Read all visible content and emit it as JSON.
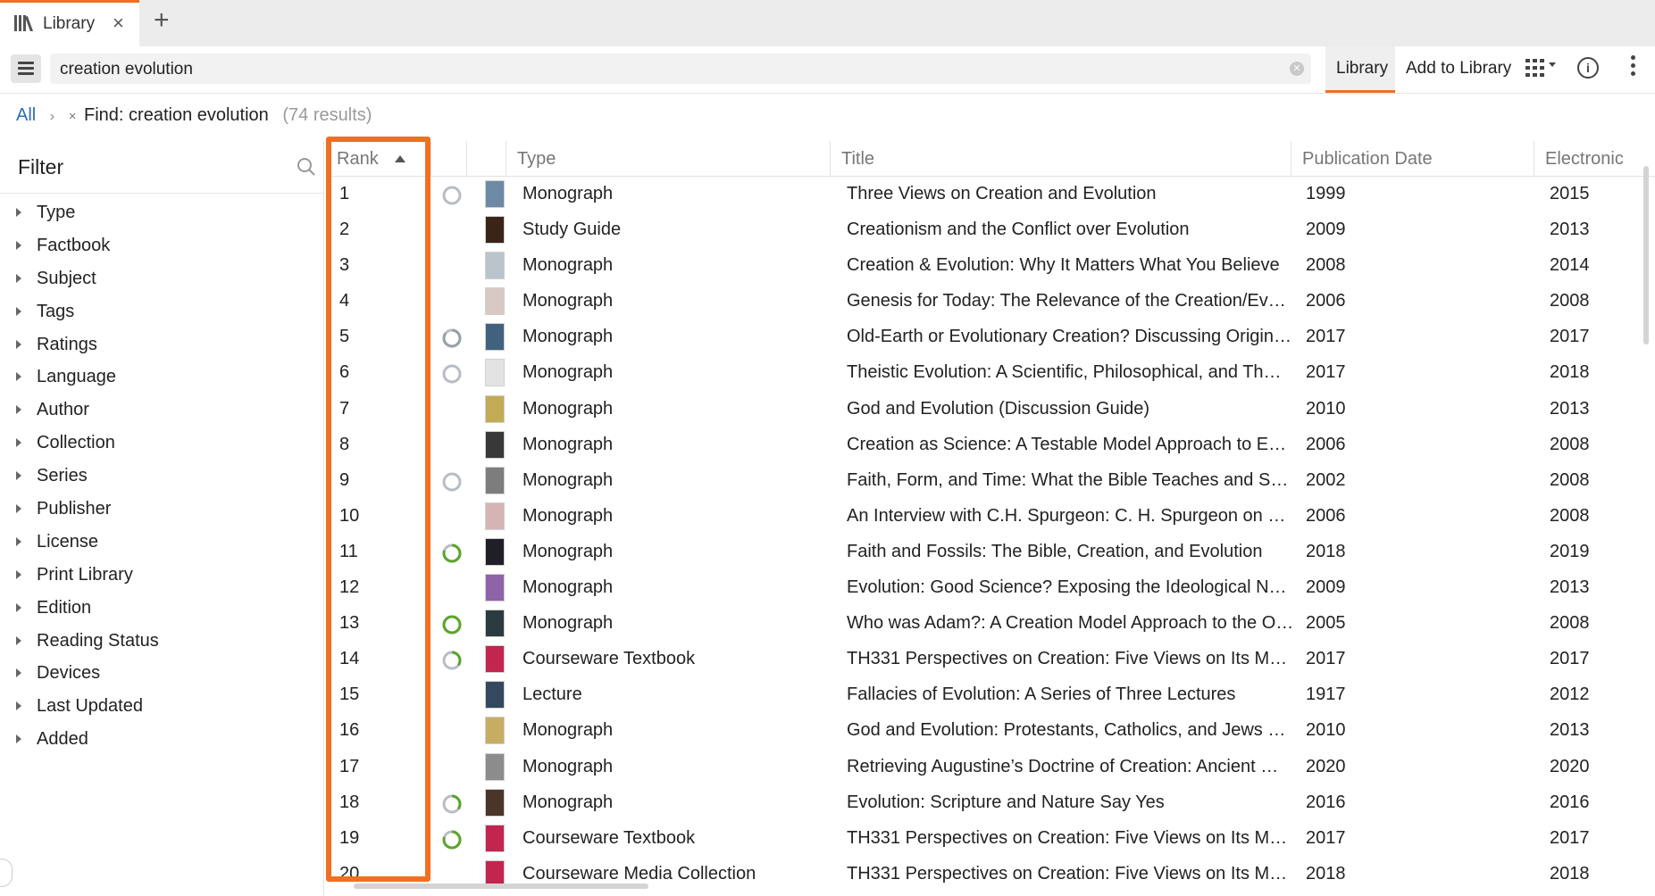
{
  "tab": {
    "label": "Library",
    "close": "×",
    "add": "+"
  },
  "toolbar": {
    "search_value": "creation evolution",
    "library_button": "Library",
    "add_to_library": "Add to Library",
    "info": "i"
  },
  "breadcrumb": {
    "all": "All",
    "separator": "›",
    "remove": "×",
    "find": "Find: creation evolution",
    "count": "(74 results)"
  },
  "filter": {
    "title": "Filter",
    "items": [
      "Type",
      "Factbook",
      "Subject",
      "Tags",
      "Ratings",
      "Language",
      "Author",
      "Collection",
      "Series",
      "Publisher",
      "License",
      "Print Library",
      "Edition",
      "Reading Status",
      "Devices",
      "Last Updated",
      "Added"
    ]
  },
  "table": {
    "columns": {
      "rank": "Rank",
      "type": "Type",
      "title": "Title",
      "pub_date": "Publication Date",
      "electronic": "Electronic"
    },
    "rows": [
      {
        "rank": "1",
        "status": "empty",
        "thumb": "#6c8aa5",
        "type": "Monograph",
        "title": "Three Views on Creation and Evolution",
        "pub": "1999",
        "elec": "2015"
      },
      {
        "rank": "2",
        "status": "none",
        "thumb": "#3a2418",
        "type": "Study Guide",
        "title": "Creationism and the Conflict over Evolution",
        "pub": "2009",
        "elec": "2013"
      },
      {
        "rank": "3",
        "status": "none",
        "thumb": "#b9c4cc",
        "type": "Monograph",
        "title": "Creation & Evolution: Why It Matters What You Believe",
        "pub": "2008",
        "elec": "2014"
      },
      {
        "rank": "4",
        "status": "none",
        "thumb": "#d8c9c4",
        "type": "Monograph",
        "title": "Genesis for Today: The Relevance of the Creation/Evol…",
        "pub": "2006",
        "elec": "2008"
      },
      {
        "rank": "5",
        "status": "partial-gray",
        "thumb": "#41627e",
        "type": "Monograph",
        "title": "Old-Earth or Evolutionary Creation? Discussing Origin…",
        "pub": "2017",
        "elec": "2017"
      },
      {
        "rank": "6",
        "status": "empty",
        "thumb": "#e3e3e3",
        "type": "Monograph",
        "title": "Theistic Evolution: A Scientific, Philosophical, and Th…",
        "pub": "2017",
        "elec": "2018"
      },
      {
        "rank": "7",
        "status": "none",
        "thumb": "#c3aa55",
        "type": "Monograph",
        "title": "God and Evolution (Discussion Guide)",
        "pub": "2010",
        "elec": "2013"
      },
      {
        "rank": "8",
        "status": "none",
        "thumb": "#383838",
        "type": "Monograph",
        "title": "Creation as Science: A Testable Model Approach to En…",
        "pub": "2006",
        "elec": "2008"
      },
      {
        "rank": "9",
        "status": "empty",
        "thumb": "#7d7d7d",
        "type": "Monograph",
        "title": "Faith, Form, and Time: What the Bible Teaches and Sc…",
        "pub": "2002",
        "elec": "2008"
      },
      {
        "rank": "10",
        "status": "none",
        "thumb": "#d6b4b4",
        "type": "Monograph",
        "title": "An Interview with C.H. Spurgeon: C. H. Spurgeon on C…",
        "pub": "2006",
        "elec": "2008"
      },
      {
        "rank": "11",
        "status": "green-partial",
        "thumb": "#1f1f28",
        "type": "Monograph",
        "title": "Faith and Fossils: The Bible, Creation, and Evolution",
        "pub": "2018",
        "elec": "2019"
      },
      {
        "rank": "12",
        "status": "none",
        "thumb": "#8f63a8",
        "type": "Monograph",
        "title": "Evolution: Good Science? Exposing the Ideological Na…",
        "pub": "2009",
        "elec": "2013"
      },
      {
        "rank": "13",
        "status": "green-full",
        "thumb": "#2c3b40",
        "type": "Monograph",
        "title": "Who was Adam?: A Creation Model Approach to the Or…",
        "pub": "2005",
        "elec": "2008"
      },
      {
        "rank": "14",
        "status": "green-small",
        "thumb": "#c0264f",
        "type": "Courseware Textbook",
        "title": "TH331 Perspectives on Creation: Five Views on Its Mea…",
        "pub": "2017",
        "elec": "2017"
      },
      {
        "rank": "15",
        "status": "none",
        "thumb": "#34495e",
        "type": "Lecture",
        "title": "Fallacies of Evolution: A Series of Three Lectures",
        "pub": "1917",
        "elec": "2012"
      },
      {
        "rank": "16",
        "status": "none",
        "thumb": "#c7ad62",
        "type": "Monograph",
        "title": "God and Evolution: Protestants, Catholics, and Jews E…",
        "pub": "2010",
        "elec": "2013"
      },
      {
        "rank": "17",
        "status": "none",
        "thumb": "#8c8c8c",
        "type": "Monograph",
        "title": "Retrieving Augustine’s Doctrine of Creation: Ancient W…",
        "pub": "2020",
        "elec": "2020"
      },
      {
        "rank": "18",
        "status": "green-small",
        "thumb": "#4a3528",
        "type": "Monograph",
        "title": "Evolution: Scripture and Nature Say Yes",
        "pub": "2016",
        "elec": "2016"
      },
      {
        "rank": "19",
        "status": "green-partial",
        "thumb": "#c0264f",
        "type": "Courseware Textbook",
        "title": "TH331 Perspectives on Creation: Five Views on Its Mea…",
        "pub": "2017",
        "elec": "2017"
      },
      {
        "rank": "20",
        "status": "none",
        "thumb": "#c0264f",
        "type": "Courseware Media Collection",
        "title": "TH331 Perspectives on Creation: Five Views on Its Mea…",
        "pub": "2018",
        "elec": "2018"
      }
    ]
  },
  "colors": {
    "accent": "#f26f21",
    "link": "#2a6ebf",
    "progress_green": "#5aa52b",
    "progress_gray": "#b8bcc4"
  }
}
